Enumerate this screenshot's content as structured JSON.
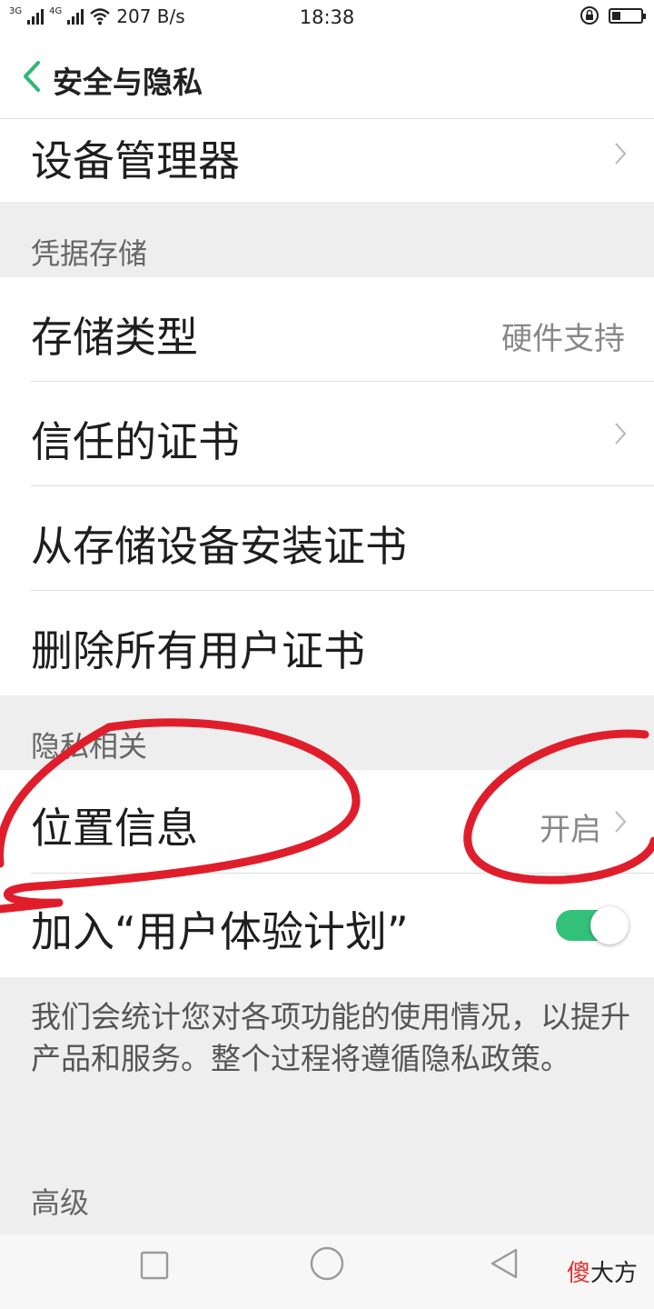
{
  "status_bar": {
    "network_1": "3G",
    "network_2": "4G",
    "speed": "207 B/s",
    "time": "18:38",
    "battery_level_percent": 30
  },
  "header": {
    "title": "安全与隐私"
  },
  "rows": {
    "device_manager": {
      "label": "设备管理器"
    },
    "storage_type": {
      "label": "存储类型",
      "value": "硬件支持"
    },
    "trusted_certs": {
      "label": "信任的证书"
    },
    "install_from_storage": {
      "label": "从存储设备安装证书"
    },
    "remove_user_certs": {
      "label": "删除所有用户证书"
    },
    "location": {
      "label": "位置信息",
      "value": "开启"
    },
    "ux_program": {
      "label": "加入“用户体验计划”",
      "toggle_on": true
    }
  },
  "sections": {
    "credential_storage": "凭据存储",
    "privacy": "隐私相关",
    "advanced": "高级"
  },
  "description": "我们会统计您对各项功能的使用情况，以提升产品和服务。整个过程将遵循隐私政策。",
  "watermark": {
    "part1": "傻",
    "part2": "大方"
  },
  "colors": {
    "accent_green": "#33c17a",
    "annotation_red": "#e01e2b",
    "back_arrow": "#2eb872"
  }
}
